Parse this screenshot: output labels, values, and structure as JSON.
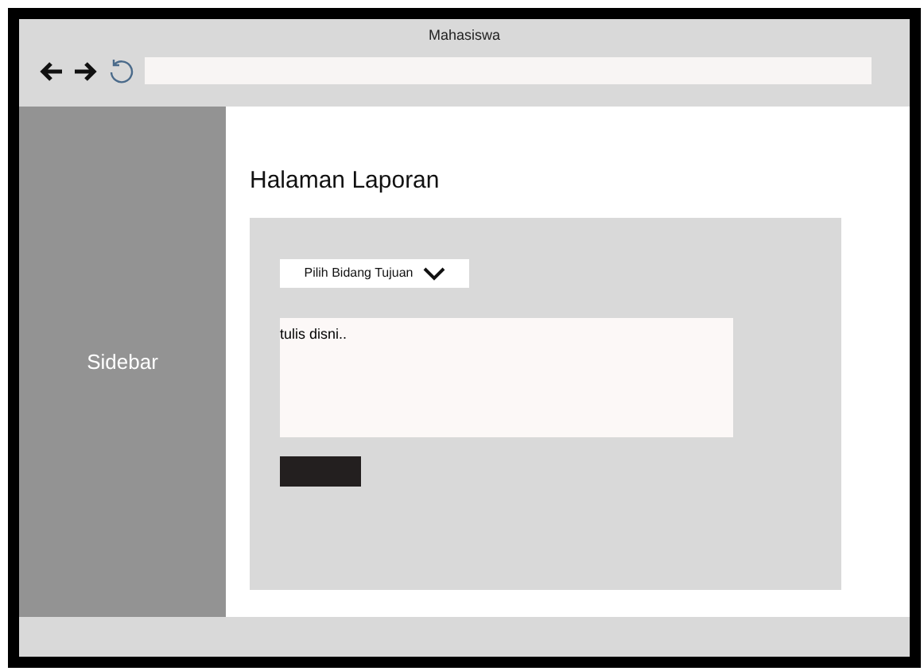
{
  "window": {
    "title": "Mahasiswa"
  },
  "sidebar": {
    "label": "Sidebar"
  },
  "page": {
    "heading": "Halaman Laporan",
    "dropdown": {
      "label": "Pilih Bidang Tujuan"
    },
    "textarea": {
      "placeholder": "tulis disni.."
    }
  }
}
